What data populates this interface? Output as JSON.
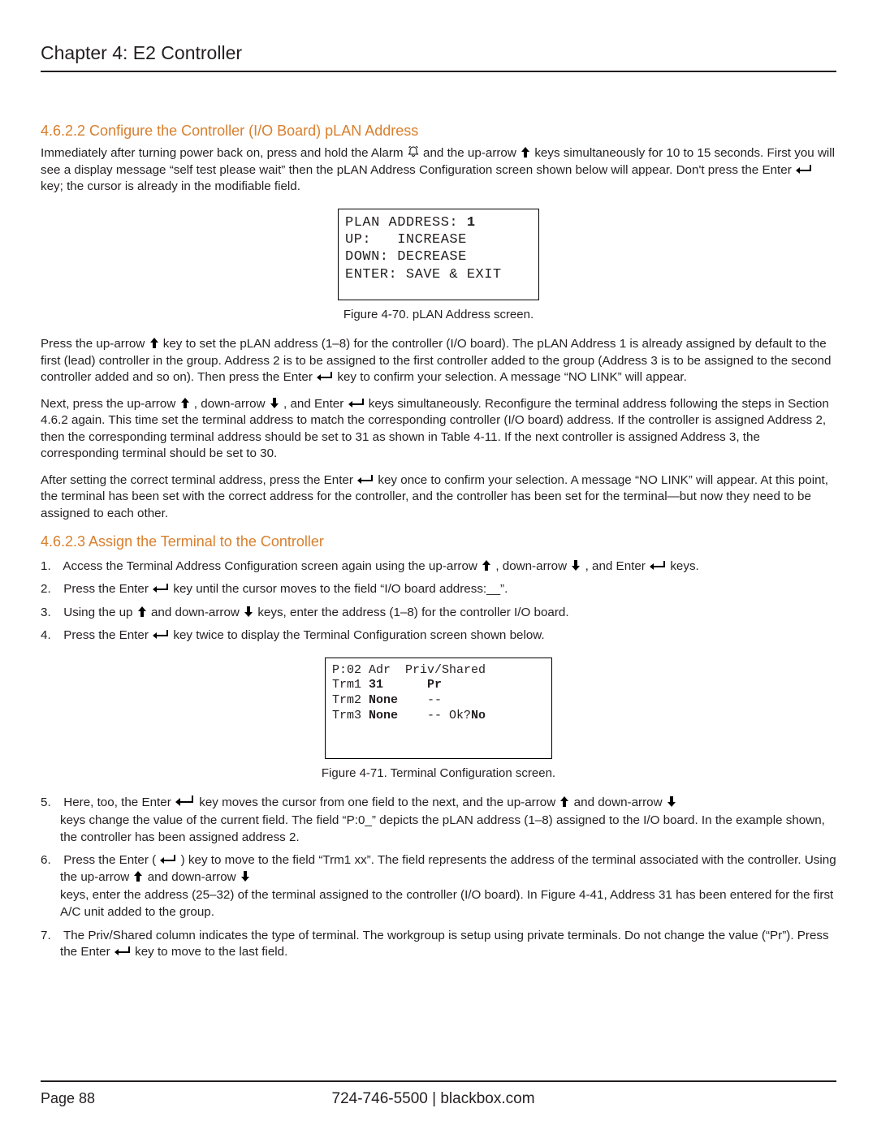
{
  "chapter": "Chapter 4: E2 Controller",
  "section_4_6_2_2": {
    "heading": "4.6.2.2 Configure the Controller (I/O Board) pLAN Address",
    "p1a": "Immediately after turning power back on, press and hold the Alarm ",
    "p1b": " and the up-arrow ",
    "p1c": " keys simultaneously for 10 to 15 seconds. First you will see a display message “self test please wait” then the pLAN Address Configuration screen shown below will appear. Don't press the Enter ",
    "p1d": " key; the cursor is already in the modifiable field.",
    "screen1_line1a": "PLAN ADDRESS: ",
    "screen1_line1b": "1",
    "screen1_line2": "UP:   INCREASE",
    "screen1_line3": "DOWN: DECREASE",
    "screen1_line4": "ENTER: SAVE & EXIT",
    "fig70": "Figure 4-70. pLAN Address screen.",
    "p2a": "Press the up-arrow ",
    "p2b": " key to set the pLAN address (1–8) for the controller (I/O board). The pLAN Address 1 is already assigned by default to the first (lead) controller in the group. Address 2 is to be assigned to the first controller added to the group (Address 3 is to be assigned to the second controller added and so on). Then press the Enter ",
    "p2c": " key to confirm your selection. A message “NO LINK” will appear.",
    "p3a": "Next, press the up-arrow ",
    "p3b": ", down-arrow ",
    "p3c": ", and Enter ",
    "p3d": " keys simultaneously. Reconfigure the terminal address following the steps in Section 4.6.2 again. This time set the terminal address to match the corresponding controller (I/O board) address. If the controller is assigned Address 2, then the corresponding terminal address should be set to 31 as shown in Table 4-11. If the next controller is assigned Address 3, the corresponding terminal should be set to 30.",
    "p4a": "After setting the correct terminal address, press the Enter ",
    "p4b": " key once to confirm your selection. A message “NO LINK” will appear. At this point, the terminal has been set with the correct address for the controller, and the controller has been set for the terminal—but now they need to be assigned to each other."
  },
  "section_4_6_2_3": {
    "heading": "4.6.2.3 Assign the Terminal to the Controller",
    "step1a": "Access the Terminal Address Configuration screen again using the up-arrow ",
    "step1b": ", down-arrow ",
    "step1c": ", and Enter ",
    "step1d": " keys.",
    "step2a": "Press the Enter ",
    "step2b": " key until the cursor moves to the field “I/O board address:__”.",
    "step3a": "Using the up ",
    "step3b": " and down-arrow ",
    "step3c": " keys, enter the address (1–8) for the controller I/O board.",
    "step4a": "Press the Enter ",
    "step4b": " key twice to display the Terminal Configuration screen shown below.",
    "screen2_line1": "P:02 Adr  Priv/Shared",
    "screen2_line2a": "Trm1 ",
    "screen2_line2b": "31",
    "screen2_line2c": "      ",
    "screen2_line2d": "Pr",
    "screen2_line3a": "Trm2 ",
    "screen2_line3b": "None",
    "screen2_line3c": "    --",
    "screen2_line4a": "Trm3 ",
    "screen2_line4b": "None",
    "screen2_line4c": "    -- Ok?",
    "screen2_line4d": "No",
    "fig71": "Figure 4-71. Terminal Configuration screen.",
    "step5a": "Here, too, the Enter ",
    "step5b": " key moves the cursor from one field to the next, and the up-arrow ",
    "step5c": " and down-arrow ",
    "step5d": " keys change the value of the current field. The field “P:0_” depicts the pLAN address (1–8) assigned to the I/O board. In the example shown, the controller has been assigned address 2.",
    "step6a": "Press the Enter (",
    "step6b": ") key to move to the field “Trm1 xx”. The field represents the address of the terminal associated with the controller. Using the up-arrow ",
    "step6c": " and down-arrow ",
    "step6d": " keys, enter the address (25–32) of the terminal assigned to the controller (I/O board). In Figure 4-41, Address 31 has been entered for the first A/C unit added to the group.",
    "step7a": "The Priv/Shared column indicates the type of terminal. The workgroup is setup using private terminals. Do not change the value (“Pr”). Press the Enter ",
    "step7b": " key to move to the last field."
  },
  "footer": {
    "page": "Page 88",
    "phone": "724-746-5500",
    "sep": "  |  ",
    "site": "blackbox.com"
  }
}
